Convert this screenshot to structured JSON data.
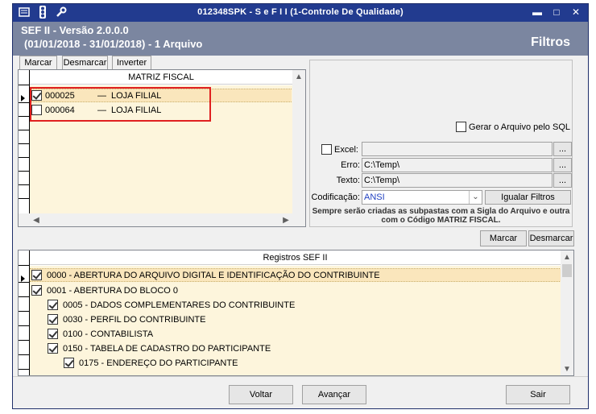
{
  "titlebar": {
    "title": "012348SPK - S e F  I I (1-Controle De Qualidade)",
    "icons": [
      "menu-icon",
      "traffic-light-icon",
      "wrench-icon"
    ],
    "minimize": "▬",
    "maximize": "□",
    "close": "✕"
  },
  "header": {
    "app_version": "SEF II - Versão 2.0.0.0",
    "period": "(01/01/2018 - 31/01/2018) - 1 Arquivo",
    "section": "Filtros"
  },
  "tabs": [
    {
      "label": "Marcar"
    },
    {
      "label": "Desmarcar"
    },
    {
      "label": "Inverter"
    }
  ],
  "matriz": {
    "column_header": "MATRIZ FISCAL",
    "rows": [
      {
        "code": "000025",
        "sep": "—",
        "name": "LOJA FILIAL",
        "checked": true,
        "selected": true
      },
      {
        "code": "000064",
        "sep": "—",
        "name": "LOJA FILIAL",
        "checked": false,
        "selected": false
      }
    ]
  },
  "options": {
    "gerar_sql_label": "Gerar o Arquivo pelo SQL",
    "excel_label": "Excel:",
    "excel_value": "",
    "erro_label": "Erro:",
    "erro_value": "C:\\Temp\\",
    "texto_label": "Texto:",
    "texto_value": "C:\\Temp\\",
    "browse_label": "...",
    "codificacao_label": "Codificação:",
    "codificacao_value": "ANSI",
    "igualar_label": "Igualar Filtros",
    "note": "Sempre serão criadas as subpastas com a Sigla do Arquivo e outra com o Código MATRIZ FISCAL."
  },
  "registros_buttons": {
    "marcar": "Marcar",
    "desmarcar": "Desmarcar"
  },
  "registros": {
    "column_header": "Registros SEF II",
    "rows": [
      {
        "label": "0000 - ABERTURA DO ARQUIVO DIGITAL E IDENTIFICAÇÃO DO CONTRIBUINTE",
        "level": 0,
        "checked": true,
        "selected": true
      },
      {
        "label": "0001 - ABERTURA DO BLOCO 0",
        "level": 0,
        "checked": true,
        "selected": false
      },
      {
        "label": "0005 - DADOS COMPLEMENTARES DO CONTRIBUINTE",
        "level": 1,
        "checked": true,
        "selected": false
      },
      {
        "label": "0030 - PERFIL DO CONTRIBUINTE",
        "level": 1,
        "checked": true,
        "selected": false
      },
      {
        "label": "0100 - CONTABILISTA",
        "level": 1,
        "checked": true,
        "selected": false
      },
      {
        "label": "0150 - TABELA DE CADASTRO DO PARTICIPANTE",
        "level": 1,
        "checked": true,
        "selected": false
      },
      {
        "label": "0175 - ENDEREÇO DO PARTICIPANTE",
        "level": 2,
        "checked": true,
        "selected": false
      }
    ]
  },
  "footer": {
    "voltar": "Voltar",
    "avancar": "Avançar",
    "sair": "Sair"
  },
  "colors": {
    "titlebar": "#223b8f",
    "header": "#7b86a0",
    "grid_bg": "#fdf5dc",
    "selected_row": "#fae6bc",
    "highlight_border": "#e02020"
  }
}
